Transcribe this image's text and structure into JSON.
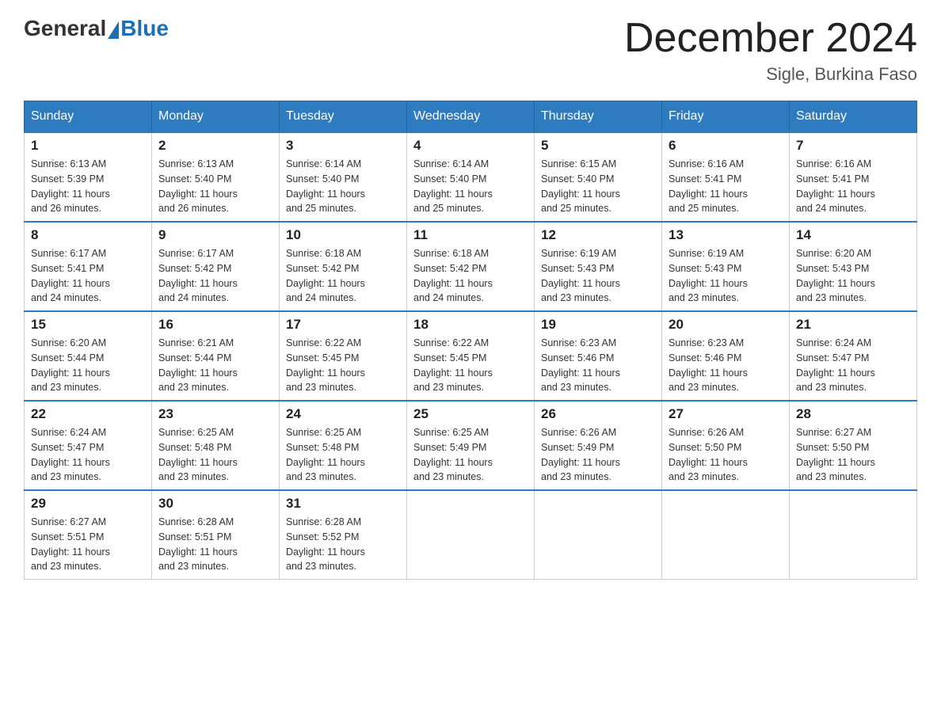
{
  "header": {
    "logo_general": "General",
    "logo_blue": "Blue",
    "month_title": "December 2024",
    "location": "Sigle, Burkina Faso"
  },
  "days_of_week": [
    "Sunday",
    "Monday",
    "Tuesday",
    "Wednesday",
    "Thursday",
    "Friday",
    "Saturday"
  ],
  "weeks": [
    [
      {
        "day": "1",
        "sunrise": "6:13 AM",
        "sunset": "5:39 PM",
        "daylight": "11 hours and 26 minutes."
      },
      {
        "day": "2",
        "sunrise": "6:13 AM",
        "sunset": "5:40 PM",
        "daylight": "11 hours and 26 minutes."
      },
      {
        "day": "3",
        "sunrise": "6:14 AM",
        "sunset": "5:40 PM",
        "daylight": "11 hours and 25 minutes."
      },
      {
        "day": "4",
        "sunrise": "6:14 AM",
        "sunset": "5:40 PM",
        "daylight": "11 hours and 25 minutes."
      },
      {
        "day": "5",
        "sunrise": "6:15 AM",
        "sunset": "5:40 PM",
        "daylight": "11 hours and 25 minutes."
      },
      {
        "day": "6",
        "sunrise": "6:16 AM",
        "sunset": "5:41 PM",
        "daylight": "11 hours and 25 minutes."
      },
      {
        "day": "7",
        "sunrise": "6:16 AM",
        "sunset": "5:41 PM",
        "daylight": "11 hours and 24 minutes."
      }
    ],
    [
      {
        "day": "8",
        "sunrise": "6:17 AM",
        "sunset": "5:41 PM",
        "daylight": "11 hours and 24 minutes."
      },
      {
        "day": "9",
        "sunrise": "6:17 AM",
        "sunset": "5:42 PM",
        "daylight": "11 hours and 24 minutes."
      },
      {
        "day": "10",
        "sunrise": "6:18 AM",
        "sunset": "5:42 PM",
        "daylight": "11 hours and 24 minutes."
      },
      {
        "day": "11",
        "sunrise": "6:18 AM",
        "sunset": "5:42 PM",
        "daylight": "11 hours and 24 minutes."
      },
      {
        "day": "12",
        "sunrise": "6:19 AM",
        "sunset": "5:43 PM",
        "daylight": "11 hours and 23 minutes."
      },
      {
        "day": "13",
        "sunrise": "6:19 AM",
        "sunset": "5:43 PM",
        "daylight": "11 hours and 23 minutes."
      },
      {
        "day": "14",
        "sunrise": "6:20 AM",
        "sunset": "5:43 PM",
        "daylight": "11 hours and 23 minutes."
      }
    ],
    [
      {
        "day": "15",
        "sunrise": "6:20 AM",
        "sunset": "5:44 PM",
        "daylight": "11 hours and 23 minutes."
      },
      {
        "day": "16",
        "sunrise": "6:21 AM",
        "sunset": "5:44 PM",
        "daylight": "11 hours and 23 minutes."
      },
      {
        "day": "17",
        "sunrise": "6:22 AM",
        "sunset": "5:45 PM",
        "daylight": "11 hours and 23 minutes."
      },
      {
        "day": "18",
        "sunrise": "6:22 AM",
        "sunset": "5:45 PM",
        "daylight": "11 hours and 23 minutes."
      },
      {
        "day": "19",
        "sunrise": "6:23 AM",
        "sunset": "5:46 PM",
        "daylight": "11 hours and 23 minutes."
      },
      {
        "day": "20",
        "sunrise": "6:23 AM",
        "sunset": "5:46 PM",
        "daylight": "11 hours and 23 minutes."
      },
      {
        "day": "21",
        "sunrise": "6:24 AM",
        "sunset": "5:47 PM",
        "daylight": "11 hours and 23 minutes."
      }
    ],
    [
      {
        "day": "22",
        "sunrise": "6:24 AM",
        "sunset": "5:47 PM",
        "daylight": "11 hours and 23 minutes."
      },
      {
        "day": "23",
        "sunrise": "6:25 AM",
        "sunset": "5:48 PM",
        "daylight": "11 hours and 23 minutes."
      },
      {
        "day": "24",
        "sunrise": "6:25 AM",
        "sunset": "5:48 PM",
        "daylight": "11 hours and 23 minutes."
      },
      {
        "day": "25",
        "sunrise": "6:25 AM",
        "sunset": "5:49 PM",
        "daylight": "11 hours and 23 minutes."
      },
      {
        "day": "26",
        "sunrise": "6:26 AM",
        "sunset": "5:49 PM",
        "daylight": "11 hours and 23 minutes."
      },
      {
        "day": "27",
        "sunrise": "6:26 AM",
        "sunset": "5:50 PM",
        "daylight": "11 hours and 23 minutes."
      },
      {
        "day": "28",
        "sunrise": "6:27 AM",
        "sunset": "5:50 PM",
        "daylight": "11 hours and 23 minutes."
      }
    ],
    [
      {
        "day": "29",
        "sunrise": "6:27 AM",
        "sunset": "5:51 PM",
        "daylight": "11 hours and 23 minutes."
      },
      {
        "day": "30",
        "sunrise": "6:28 AM",
        "sunset": "5:51 PM",
        "daylight": "11 hours and 23 minutes."
      },
      {
        "day": "31",
        "sunrise": "6:28 AM",
        "sunset": "5:52 PM",
        "daylight": "11 hours and 23 minutes."
      },
      null,
      null,
      null,
      null
    ]
  ],
  "labels": {
    "sunrise": "Sunrise:",
    "sunset": "Sunset:",
    "daylight": "Daylight:"
  }
}
